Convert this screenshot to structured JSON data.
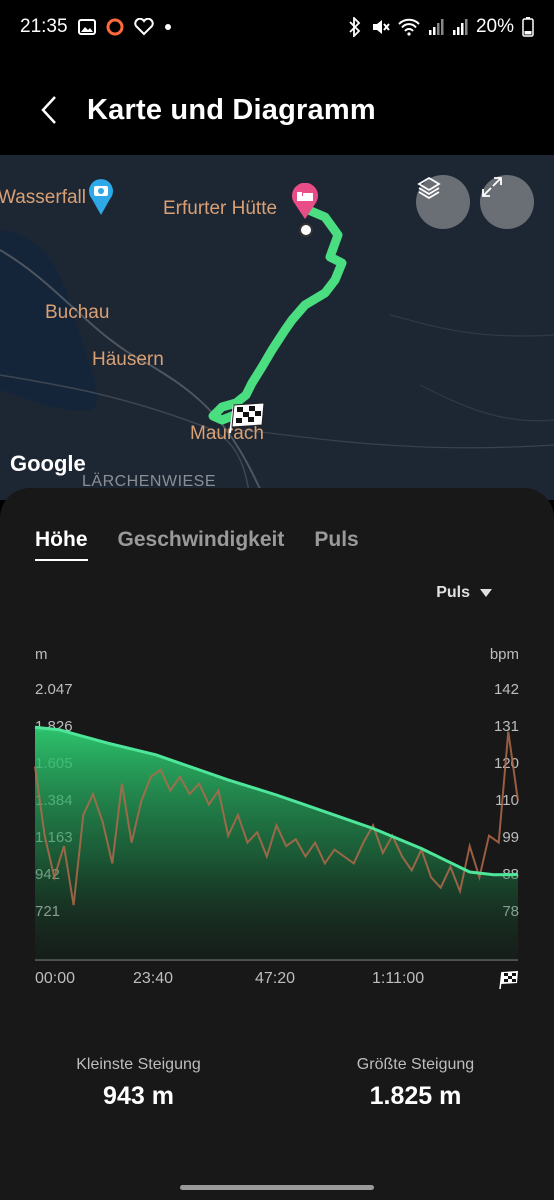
{
  "status_bar": {
    "time": "21:35",
    "battery": "20%",
    "icons": [
      "gallery-icon",
      "circle-icon",
      "heart-icon",
      "dot-icon",
      "bluetooth-icon",
      "mute-icon",
      "wifi-icon",
      "signal-icon",
      "signal-icon",
      "battery-icon"
    ]
  },
  "header": {
    "title": "Karte und Diagramm",
    "back_icon": "chevron-left-icon"
  },
  "map": {
    "labels": {
      "wasserfall": "Wasserfall",
      "erfurter_huette": "Erfurter Hütte",
      "buchau": "Buchau",
      "haeusern": "Häusern",
      "maurach": "Maurach",
      "laerchenwiese": "LÄRCHENWIESE"
    },
    "google": "Google",
    "route_color": "#4ade80",
    "buttons": {
      "layers_icon": "layers-icon",
      "expand_icon": "expand-icon"
    }
  },
  "tabs": [
    {
      "label": "Höhe",
      "active": true
    },
    {
      "label": "Geschwindigkeit",
      "active": false
    },
    {
      "label": "Puls",
      "active": false
    }
  ],
  "dropdown": {
    "label": "Puls"
  },
  "chart_data": {
    "type": "area",
    "left_unit": "m",
    "right_unit": "bpm",
    "left_ticks": [
      "2.047",
      "1.826",
      "1.605",
      "1.384",
      "1.163",
      "942",
      "721"
    ],
    "right_ticks": [
      "142",
      "131",
      "120",
      "110",
      "99",
      "88",
      "78"
    ],
    "x_ticks": [
      "00:00",
      "23:40",
      "47:20",
      "1:11:00"
    ],
    "series": [
      {
        "name": "Höhe",
        "color": "#3ddc84",
        "x_minutes": [
          0,
          5,
          10,
          15,
          20,
          25,
          30,
          35,
          40,
          45,
          50,
          55,
          60,
          65,
          70,
          75,
          80,
          85,
          90,
          95,
          100
        ],
        "values": [
          1825,
          1810,
          1770,
          1730,
          1695,
          1660,
          1610,
          1560,
          1510,
          1465,
          1420,
          1370,
          1320,
          1270,
          1220,
          1160,
          1100,
          1030,
          960,
          943,
          945
        ]
      },
      {
        "name": "Puls",
        "color": "#b06a4a",
        "x_minutes": [
          0,
          2,
          4,
          6,
          8,
          10,
          12,
          14,
          16,
          18,
          20,
          22,
          24,
          26,
          28,
          30,
          32,
          34,
          36,
          38,
          40,
          42,
          44,
          46,
          48,
          50,
          52,
          54,
          56,
          58,
          60,
          62,
          64,
          66,
          68,
          70,
          72,
          74,
          76,
          78,
          80,
          82,
          84,
          86,
          88,
          90,
          92,
          94,
          96,
          98,
          100
        ],
        "values": [
          120,
          100,
          88,
          97,
          80,
          106,
          112,
          104,
          92,
          115,
          98,
          110,
          117,
          119,
          113,
          117,
          112,
          115,
          109,
          113,
          100,
          106,
          98,
          101,
          94,
          103,
          97,
          99,
          94,
          98,
          92,
          96,
          94,
          92,
          98,
          103,
          95,
          100,
          94,
          90,
          96,
          88,
          85,
          91,
          84,
          97,
          88,
          100,
          98,
          130,
          110
        ]
      }
    ],
    "y_range_left": [
      721,
      2047
    ],
    "y_range_right": [
      78,
      142
    ]
  },
  "stats": {
    "min_label": "Kleinste Steigung",
    "min_value": "943 m",
    "max_label": "Größte Steigung",
    "max_value": "1.825 m"
  }
}
